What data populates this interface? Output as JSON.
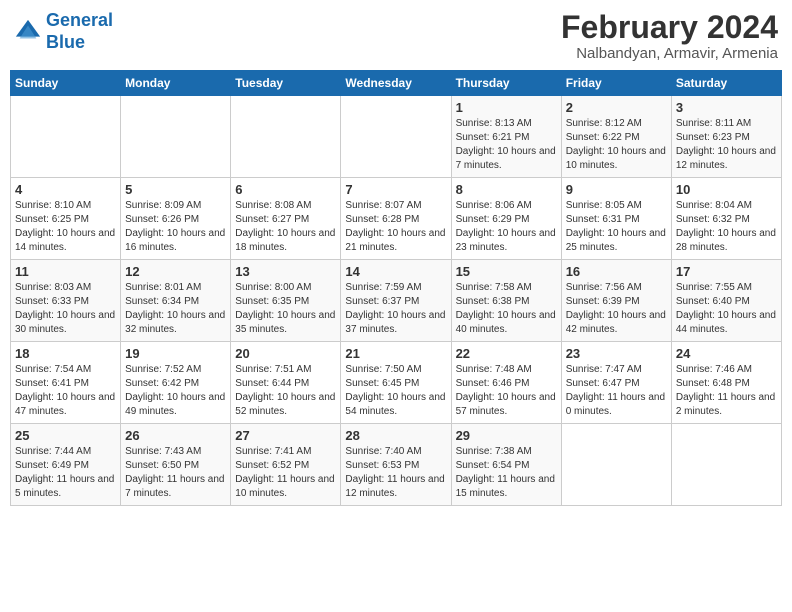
{
  "header": {
    "logo_general": "General",
    "logo_blue": "Blue",
    "title": "February 2024",
    "subtitle": "Nalbandyan, Armavir, Armenia"
  },
  "weekdays": [
    "Sunday",
    "Monday",
    "Tuesday",
    "Wednesday",
    "Thursday",
    "Friday",
    "Saturday"
  ],
  "weeks": [
    [
      {
        "day": "",
        "sunrise": "",
        "sunset": "",
        "daylight": ""
      },
      {
        "day": "",
        "sunrise": "",
        "sunset": "",
        "daylight": ""
      },
      {
        "day": "",
        "sunrise": "",
        "sunset": "",
        "daylight": ""
      },
      {
        "day": "",
        "sunrise": "",
        "sunset": "",
        "daylight": ""
      },
      {
        "day": "1",
        "sunrise": "Sunrise: 8:13 AM",
        "sunset": "Sunset: 6:21 PM",
        "daylight": "Daylight: 10 hours and 7 minutes."
      },
      {
        "day": "2",
        "sunrise": "Sunrise: 8:12 AM",
        "sunset": "Sunset: 6:22 PM",
        "daylight": "Daylight: 10 hours and 10 minutes."
      },
      {
        "day": "3",
        "sunrise": "Sunrise: 8:11 AM",
        "sunset": "Sunset: 6:23 PM",
        "daylight": "Daylight: 10 hours and 12 minutes."
      }
    ],
    [
      {
        "day": "4",
        "sunrise": "Sunrise: 8:10 AM",
        "sunset": "Sunset: 6:25 PM",
        "daylight": "Daylight: 10 hours and 14 minutes."
      },
      {
        "day": "5",
        "sunrise": "Sunrise: 8:09 AM",
        "sunset": "Sunset: 6:26 PM",
        "daylight": "Daylight: 10 hours and 16 minutes."
      },
      {
        "day": "6",
        "sunrise": "Sunrise: 8:08 AM",
        "sunset": "Sunset: 6:27 PM",
        "daylight": "Daylight: 10 hours and 18 minutes."
      },
      {
        "day": "7",
        "sunrise": "Sunrise: 8:07 AM",
        "sunset": "Sunset: 6:28 PM",
        "daylight": "Daylight: 10 hours and 21 minutes."
      },
      {
        "day": "8",
        "sunrise": "Sunrise: 8:06 AM",
        "sunset": "Sunset: 6:29 PM",
        "daylight": "Daylight: 10 hours and 23 minutes."
      },
      {
        "day": "9",
        "sunrise": "Sunrise: 8:05 AM",
        "sunset": "Sunset: 6:31 PM",
        "daylight": "Daylight: 10 hours and 25 minutes."
      },
      {
        "day": "10",
        "sunrise": "Sunrise: 8:04 AM",
        "sunset": "Sunset: 6:32 PM",
        "daylight": "Daylight: 10 hours and 28 minutes."
      }
    ],
    [
      {
        "day": "11",
        "sunrise": "Sunrise: 8:03 AM",
        "sunset": "Sunset: 6:33 PM",
        "daylight": "Daylight: 10 hours and 30 minutes."
      },
      {
        "day": "12",
        "sunrise": "Sunrise: 8:01 AM",
        "sunset": "Sunset: 6:34 PM",
        "daylight": "Daylight: 10 hours and 32 minutes."
      },
      {
        "day": "13",
        "sunrise": "Sunrise: 8:00 AM",
        "sunset": "Sunset: 6:35 PM",
        "daylight": "Daylight: 10 hours and 35 minutes."
      },
      {
        "day": "14",
        "sunrise": "Sunrise: 7:59 AM",
        "sunset": "Sunset: 6:37 PM",
        "daylight": "Daylight: 10 hours and 37 minutes."
      },
      {
        "day": "15",
        "sunrise": "Sunrise: 7:58 AM",
        "sunset": "Sunset: 6:38 PM",
        "daylight": "Daylight: 10 hours and 40 minutes."
      },
      {
        "day": "16",
        "sunrise": "Sunrise: 7:56 AM",
        "sunset": "Sunset: 6:39 PM",
        "daylight": "Daylight: 10 hours and 42 minutes."
      },
      {
        "day": "17",
        "sunrise": "Sunrise: 7:55 AM",
        "sunset": "Sunset: 6:40 PM",
        "daylight": "Daylight: 10 hours and 44 minutes."
      }
    ],
    [
      {
        "day": "18",
        "sunrise": "Sunrise: 7:54 AM",
        "sunset": "Sunset: 6:41 PM",
        "daylight": "Daylight: 10 hours and 47 minutes."
      },
      {
        "day": "19",
        "sunrise": "Sunrise: 7:52 AM",
        "sunset": "Sunset: 6:42 PM",
        "daylight": "Daylight: 10 hours and 49 minutes."
      },
      {
        "day": "20",
        "sunrise": "Sunrise: 7:51 AM",
        "sunset": "Sunset: 6:44 PM",
        "daylight": "Daylight: 10 hours and 52 minutes."
      },
      {
        "day": "21",
        "sunrise": "Sunrise: 7:50 AM",
        "sunset": "Sunset: 6:45 PM",
        "daylight": "Daylight: 10 hours and 54 minutes."
      },
      {
        "day": "22",
        "sunrise": "Sunrise: 7:48 AM",
        "sunset": "Sunset: 6:46 PM",
        "daylight": "Daylight: 10 hours and 57 minutes."
      },
      {
        "day": "23",
        "sunrise": "Sunrise: 7:47 AM",
        "sunset": "Sunset: 6:47 PM",
        "daylight": "Daylight: 11 hours and 0 minutes."
      },
      {
        "day": "24",
        "sunrise": "Sunrise: 7:46 AM",
        "sunset": "Sunset: 6:48 PM",
        "daylight": "Daylight: 11 hours and 2 minutes."
      }
    ],
    [
      {
        "day": "25",
        "sunrise": "Sunrise: 7:44 AM",
        "sunset": "Sunset: 6:49 PM",
        "daylight": "Daylight: 11 hours and 5 minutes."
      },
      {
        "day": "26",
        "sunrise": "Sunrise: 7:43 AM",
        "sunset": "Sunset: 6:50 PM",
        "daylight": "Daylight: 11 hours and 7 minutes."
      },
      {
        "day": "27",
        "sunrise": "Sunrise: 7:41 AM",
        "sunset": "Sunset: 6:52 PM",
        "daylight": "Daylight: 11 hours and 10 minutes."
      },
      {
        "day": "28",
        "sunrise": "Sunrise: 7:40 AM",
        "sunset": "Sunset: 6:53 PM",
        "daylight": "Daylight: 11 hours and 12 minutes."
      },
      {
        "day": "29",
        "sunrise": "Sunrise: 7:38 AM",
        "sunset": "Sunset: 6:54 PM",
        "daylight": "Daylight: 11 hours and 15 minutes."
      },
      {
        "day": "",
        "sunrise": "",
        "sunset": "",
        "daylight": ""
      },
      {
        "day": "",
        "sunrise": "",
        "sunset": "",
        "daylight": ""
      }
    ]
  ]
}
